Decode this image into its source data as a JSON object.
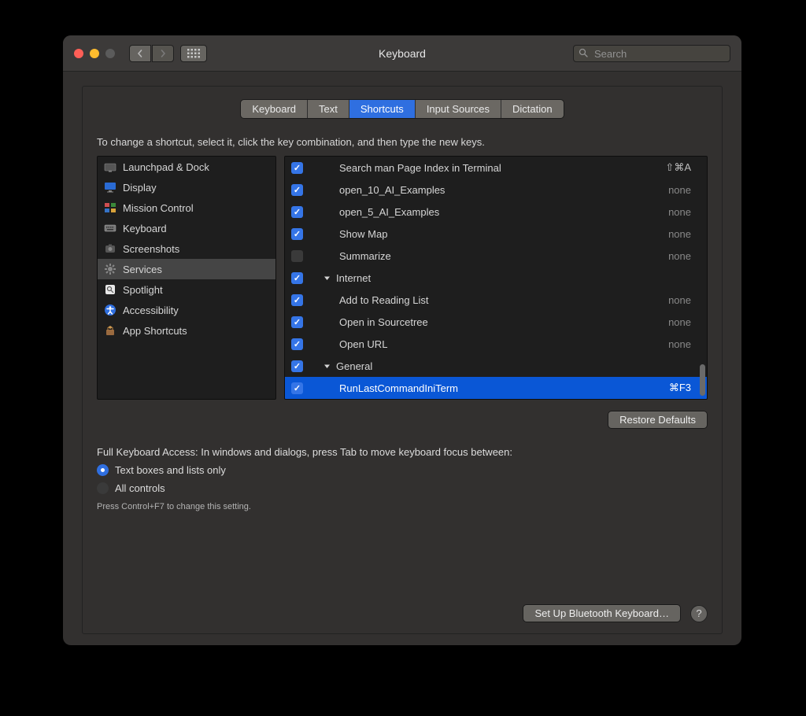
{
  "window": {
    "title": "Keyboard"
  },
  "search": {
    "placeholder": "Search",
    "value": ""
  },
  "tabs": [
    {
      "label": "Keyboard",
      "active": false
    },
    {
      "label": "Text",
      "active": false
    },
    {
      "label": "Shortcuts",
      "active": true
    },
    {
      "label": "Input Sources",
      "active": false
    },
    {
      "label": "Dictation",
      "active": false
    }
  ],
  "instruction": "To change a shortcut, select it, click the key combination, and then type the new keys.",
  "categories": [
    {
      "label": "Launchpad & Dock",
      "icon": "launchpad",
      "selected": false
    },
    {
      "label": "Display",
      "icon": "display",
      "selected": false
    },
    {
      "label": "Mission Control",
      "icon": "mission-control",
      "selected": false
    },
    {
      "label": "Keyboard",
      "icon": "keyboard",
      "selected": false
    },
    {
      "label": "Screenshots",
      "icon": "screenshots",
      "selected": false
    },
    {
      "label": "Services",
      "icon": "services",
      "selected": true
    },
    {
      "label": "Spotlight",
      "icon": "spotlight",
      "selected": false
    },
    {
      "label": "Accessibility",
      "icon": "accessibility",
      "selected": false
    },
    {
      "label": "App Shortcuts",
      "icon": "app-shortcuts",
      "selected": false
    }
  ],
  "shortcuts": [
    {
      "checked": true,
      "indent": 2,
      "group": false,
      "name": "Search man Page Index in Terminal",
      "shortcut": "⇧⌘A",
      "selected": false
    },
    {
      "checked": true,
      "indent": 2,
      "group": false,
      "name": "open_10_AI_Examples",
      "shortcut": "none",
      "selected": false
    },
    {
      "checked": true,
      "indent": 2,
      "group": false,
      "name": "open_5_AI_Examples",
      "shortcut": "none",
      "selected": false
    },
    {
      "checked": true,
      "indent": 2,
      "group": false,
      "name": "Show Map",
      "shortcut": "none",
      "selected": false
    },
    {
      "checked": false,
      "indent": 2,
      "group": false,
      "name": "Summarize",
      "shortcut": "none",
      "selected": false
    },
    {
      "checked": true,
      "indent": 1,
      "group": true,
      "name": "Internet",
      "shortcut": "",
      "selected": false
    },
    {
      "checked": true,
      "indent": 2,
      "group": false,
      "name": "Add to Reading List",
      "shortcut": "none",
      "selected": false
    },
    {
      "checked": true,
      "indent": 2,
      "group": false,
      "name": "Open in Sourcetree",
      "shortcut": "none",
      "selected": false
    },
    {
      "checked": true,
      "indent": 2,
      "group": false,
      "name": "Open URL",
      "shortcut": "none",
      "selected": false
    },
    {
      "checked": true,
      "indent": 1,
      "group": true,
      "name": "General",
      "shortcut": "",
      "selected": false
    },
    {
      "checked": true,
      "indent": 2,
      "group": false,
      "name": "RunLastCommandIniTerm",
      "shortcut": "⌘F3",
      "selected": true
    }
  ],
  "buttons": {
    "restore_defaults": "Restore Defaults",
    "bluetooth": "Set Up Bluetooth Keyboard…"
  },
  "fka": {
    "heading": "Full Keyboard Access: In windows and dialogs, press Tab to move keyboard focus between:",
    "option_textboxes": "Text boxes and lists only",
    "option_all": "All controls",
    "selected": "textboxes",
    "hint": "Press Control+F7 to change this setting."
  }
}
